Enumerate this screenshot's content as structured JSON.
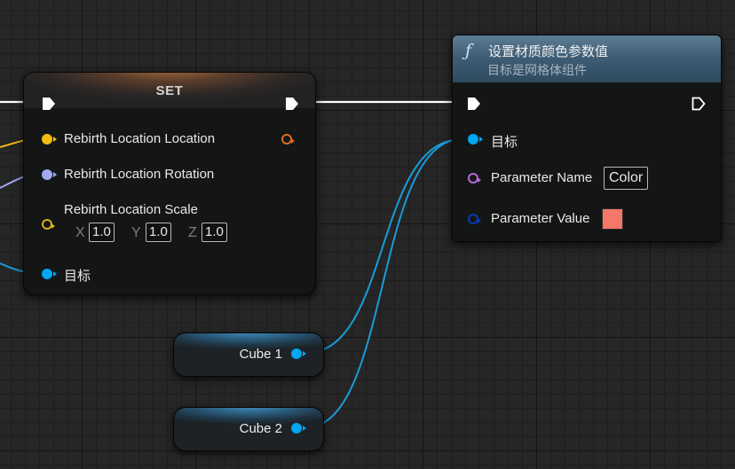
{
  "set_node": {
    "title": "SET",
    "pins": [
      {
        "label": "Rebirth Location Location",
        "color": "#f2bb10"
      },
      {
        "label": "Rebirth Location Rotation",
        "color": "#a2aaf2"
      },
      {
        "label": "Rebirth Location Scale",
        "color": "#d5b21a"
      },
      {
        "label": "目标",
        "color": "#00a6f0"
      }
    ],
    "scale": {
      "x_label": "X",
      "x_value": "1.0",
      "y_label": "Y",
      "y_value": "1.0",
      "z_label": "Z",
      "z_value": "1.0"
    },
    "output_pin_color": "#e06c1a"
  },
  "function_node": {
    "icon": "function-icon",
    "title": "设置材质颜色参数值",
    "subtitle": "目标是网格体组件",
    "pins": [
      {
        "label": "目标",
        "color": "#00a6f0"
      },
      {
        "label": "Parameter Name",
        "value": "Color",
        "color": "#b469d8"
      },
      {
        "label": "Parameter Value",
        "color": "#0838b8",
        "swatch": "#f5776a"
      }
    ]
  },
  "variables": [
    {
      "label": "Cube 1",
      "color": "#00a6f0"
    },
    {
      "label": "Cube 2",
      "color": "#00a6f0"
    }
  ],
  "colors": {
    "exec": "#ffffff",
    "object_wire": "#1b9ad8",
    "location_wire": "#f2bb10",
    "rotation_wire": "#a2aaf2"
  }
}
